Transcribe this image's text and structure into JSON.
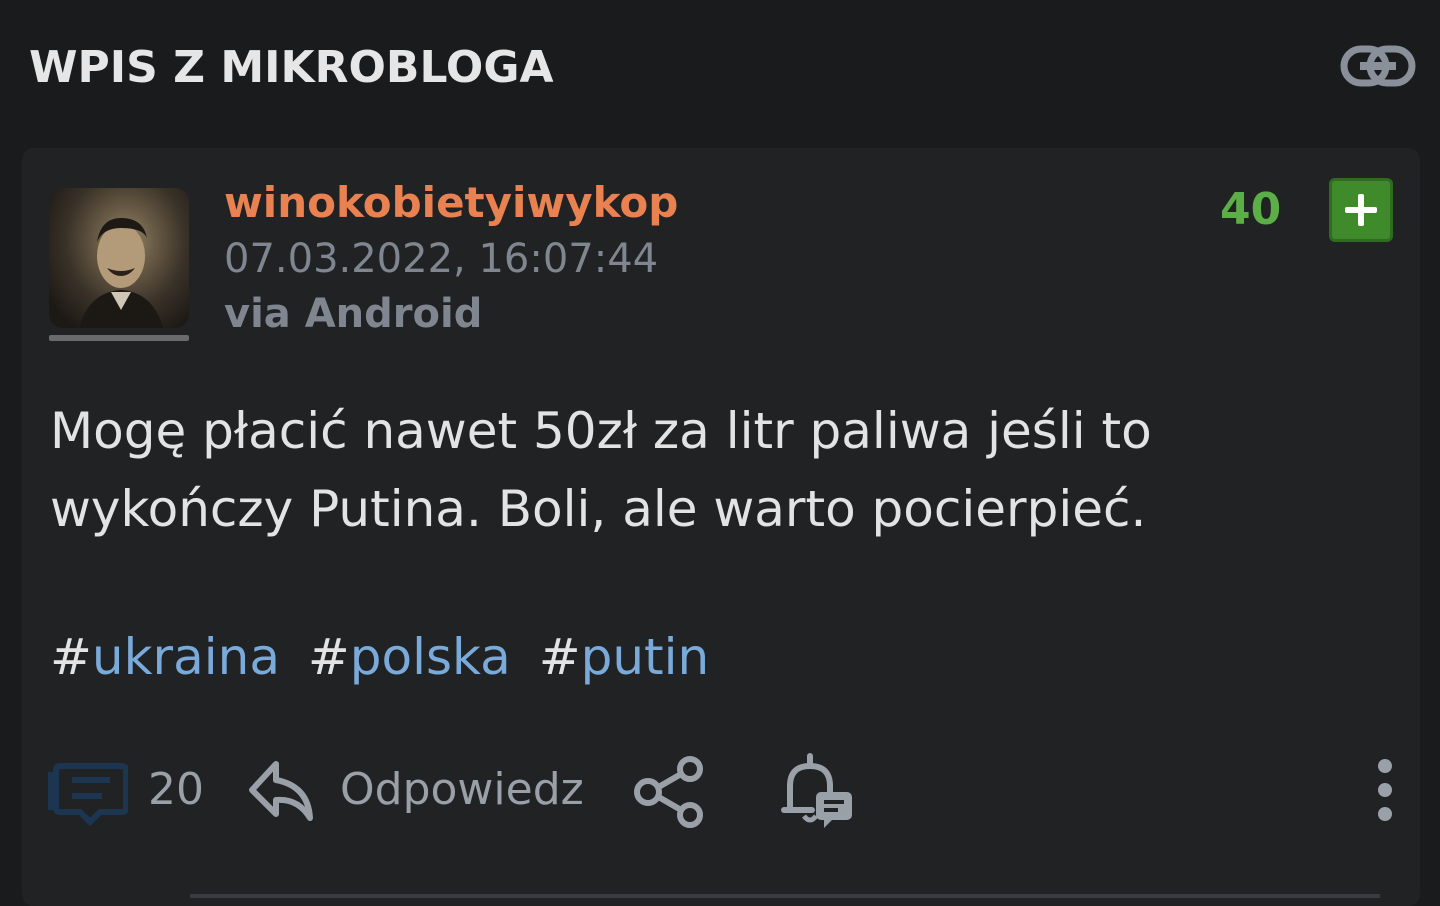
{
  "header": {
    "title": "WPIS Z MIKROBLOGA",
    "link_icon": "link-icon"
  },
  "entry": {
    "author": "winokobietyiwykop",
    "date": "07.03.2022, 16:07:44",
    "client": "via Android",
    "votes": "40",
    "text_line1": "Mogę płacić nawet 50zł za litr paliwa jeśli to",
    "text_line2": "wykończy Putina. Boli, ale warto pocierpieć.",
    "tags": [
      {
        "hash": "#",
        "name": "ukraina"
      },
      {
        "hash": "#",
        "name": "polska"
      },
      {
        "hash": "#",
        "name": "putin"
      }
    ]
  },
  "actions": {
    "comments_count": "20",
    "reply_label": "Odpowiedz",
    "icons": [
      "comments-icon",
      "reply-icon",
      "share-icon",
      "notify-icon",
      "more-icon"
    ]
  },
  "colors": {
    "username": "#e98250",
    "votes": "#5cae47",
    "plus_button": "#3f8b2c",
    "tag": "#7aaad9",
    "meta": "#7f8690",
    "comments_icon": "#1c3550"
  }
}
